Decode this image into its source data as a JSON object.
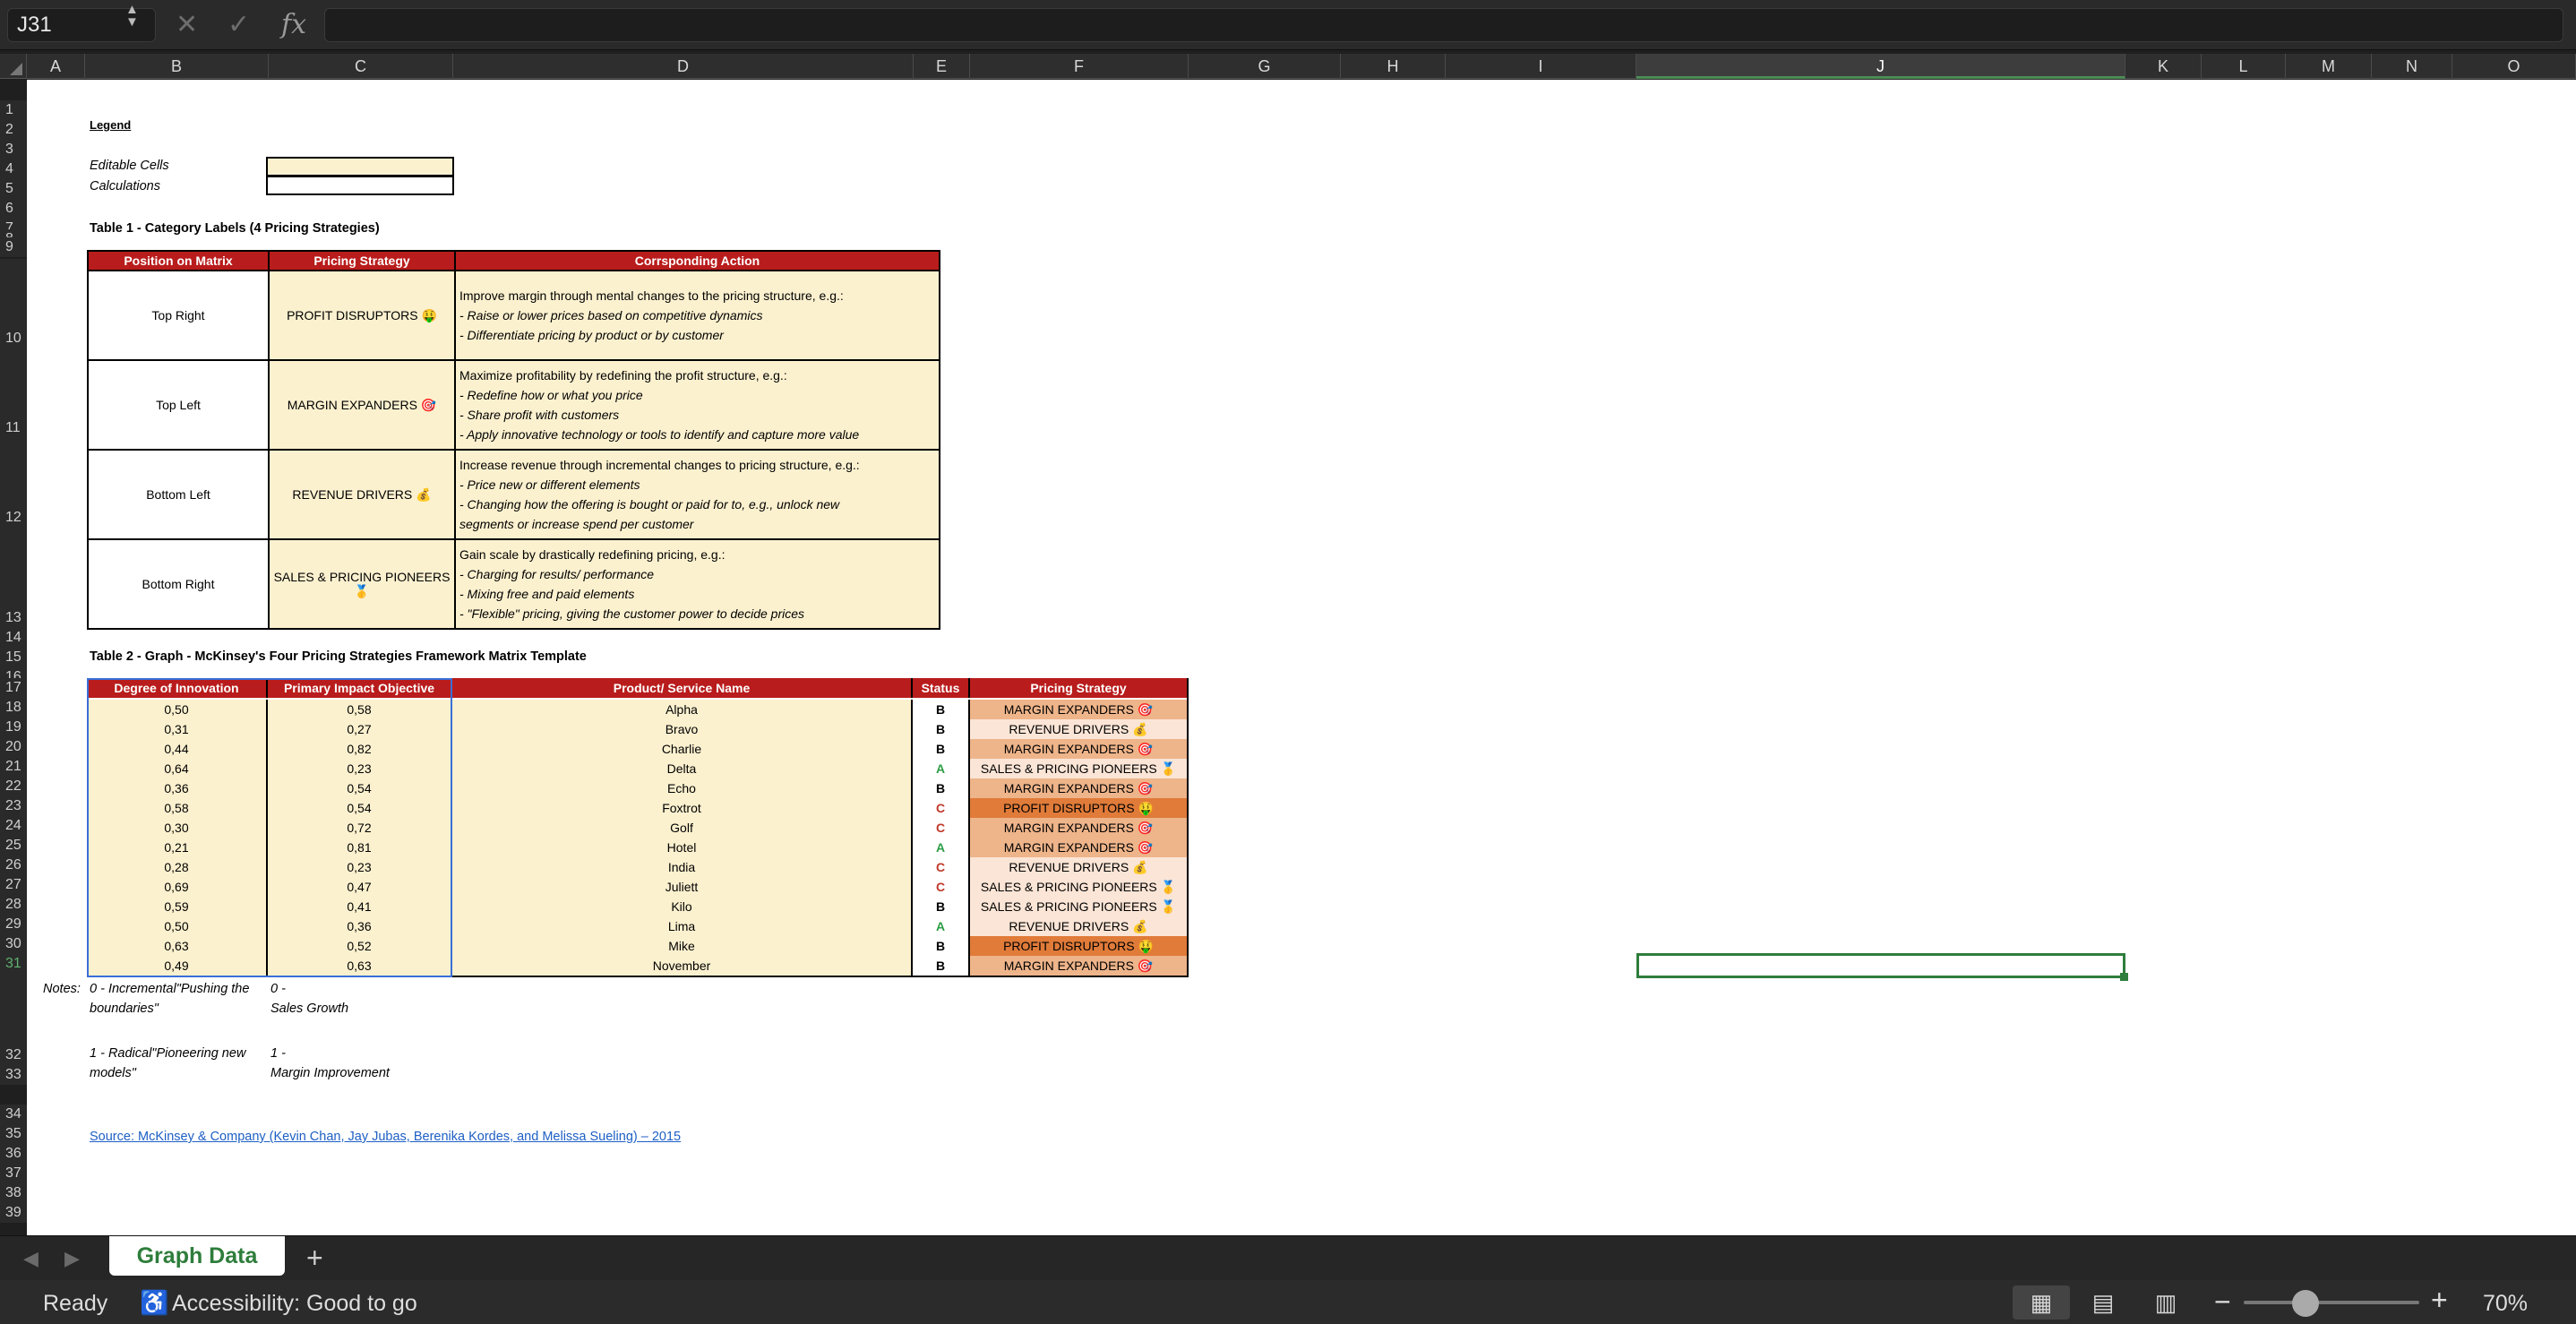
{
  "formula_bar": {
    "name_box": "J31",
    "cancel_icon": "✕",
    "enter_icon": "✓",
    "fx_label": "fx",
    "formula": ""
  },
  "columns": [
    "A",
    "B",
    "C",
    "D",
    "E",
    "F",
    "G",
    "H",
    "I",
    "J",
    "K",
    "L",
    "M",
    "N",
    "O"
  ],
  "selected_column": "J",
  "rows": [
    "1",
    "2",
    "3",
    "4",
    "5",
    "6",
    "7",
    "8",
    "9",
    "10",
    "11",
    "12",
    "13",
    "14",
    "15",
    "16",
    "17",
    "18",
    "19",
    "20",
    "21",
    "22",
    "23",
    "24",
    "25",
    "26",
    "27",
    "28",
    "29",
    "30",
    "31",
    "32",
    "33",
    "34",
    "35",
    "36",
    "37",
    "38",
    "39"
  ],
  "selected_row": "31",
  "legend": {
    "title": "Legend",
    "editable": "Editable Cells",
    "calculations": "Calculations"
  },
  "table1": {
    "title": "Table 1 - Category Labels (4 Pricing Strategies)",
    "headers": [
      "Position on Matrix",
      "Pricing Strategy",
      "Corrsponding Action"
    ],
    "rows": [
      {
        "position": "Top Right",
        "strategy": "PROFIT DISRUPTORS 🤑",
        "action_intro": "Improve margin through mental changes to the pricing structure, e.g.:",
        "action_items": [
          "- Raise or lower prices based on competitive dynamics",
          "- Differentiate pricing by product or by customer"
        ]
      },
      {
        "position": "Top Left",
        "strategy": "MARGIN EXPANDERS 🎯",
        "action_intro": "Maximize profitability by redefining the profit structure, e.g.:",
        "action_items": [
          "- Redefine how or what you price",
          "- Share profit with customers",
          "- Apply innovative technology or tools to identify and capture more value"
        ]
      },
      {
        "position": "Bottom Left",
        "strategy": "REVENUE DRIVERS 💰",
        "action_intro": "Increase revenue through incremental changes to pricing structure, e.g.:",
        "action_items": [
          "- Price new or different elements",
          "- Changing how the offering is bought or paid for to, e.g., unlock new",
          "segments or increase spend per customer"
        ]
      },
      {
        "position": "Bottom Right",
        "strategy": "SALES & PRICING PIONEERS 🥇",
        "action_intro": "Gain scale by drastically redefining pricing, e.g.:",
        "action_items": [
          "- Charging for results/ performance",
          "- Mixing free and paid elements",
          "- \"Flexible\" pricing, giving the customer power to decide prices"
        ]
      }
    ]
  },
  "table2": {
    "title": "Table 2 - Graph - McKinsey's Four Pricing Strategies Framework Matrix Template",
    "headers": [
      "Degree of Innovation",
      "Primary Impact Objective",
      "Product/ Service Name",
      "Status",
      "Pricing Strategy"
    ],
    "rows": [
      {
        "innovation": "0,50",
        "impact": "0,58",
        "name": "Alpha",
        "status": "B",
        "strategy": "MARGIN EXPANDERS 🎯"
      },
      {
        "innovation": "0,31",
        "impact": "0,27",
        "name": "Bravo",
        "status": "B",
        "strategy": "REVENUE DRIVERS 💰"
      },
      {
        "innovation": "0,44",
        "impact": "0,82",
        "name": "Charlie",
        "status": "B",
        "strategy": "MARGIN EXPANDERS 🎯"
      },
      {
        "innovation": "0,64",
        "impact": "0,23",
        "name": "Delta",
        "status": "A",
        "strategy": "SALES & PRICING PIONEERS 🥇"
      },
      {
        "innovation": "0,36",
        "impact": "0,54",
        "name": "Echo",
        "status": "B",
        "strategy": "MARGIN EXPANDERS 🎯"
      },
      {
        "innovation": "0,58",
        "impact": "0,54",
        "name": "Foxtrot",
        "status": "C",
        "strategy": "PROFIT DISRUPTORS 🤑"
      },
      {
        "innovation": "0,30",
        "impact": "0,72",
        "name": "Golf",
        "status": "C",
        "strategy": "MARGIN EXPANDERS 🎯"
      },
      {
        "innovation": "0,21",
        "impact": "0,81",
        "name": "Hotel",
        "status": "A",
        "strategy": "MARGIN EXPANDERS 🎯"
      },
      {
        "innovation": "0,28",
        "impact": "0,23",
        "name": "India",
        "status": "C",
        "strategy": "REVENUE DRIVERS 💰"
      },
      {
        "innovation": "0,69",
        "impact": "0,47",
        "name": "Juliett",
        "status": "C",
        "strategy": "SALES & PRICING PIONEERS 🥇"
      },
      {
        "innovation": "0,59",
        "impact": "0,41",
        "name": "Kilo",
        "status": "B",
        "strategy": "SALES & PRICING PIONEERS 🥇"
      },
      {
        "innovation": "0,50",
        "impact": "0,36",
        "name": "Lima",
        "status": "A",
        "strategy": "REVENUE DRIVERS 💰"
      },
      {
        "innovation": "0,63",
        "impact": "0,52",
        "name": "Mike",
        "status": "B",
        "strategy": "PROFIT DISRUPTORS 🤑"
      },
      {
        "innovation": "0,49",
        "impact": "0,63",
        "name": "November",
        "status": "B",
        "strategy": "MARGIN EXPANDERS 🎯"
      }
    ]
  },
  "notes": {
    "label": "Notes:",
    "innov_0_line1": "0 - Incremental\"Pushing the",
    "innov_0_line2": "boundaries\"",
    "impact_0_line1": "0 -",
    "impact_0_line2": "Sales Growth",
    "innov_1_line1": "1 - Radical\"Pioneering new",
    "innov_1_line2": "models\"",
    "impact_1_line1": "1 -",
    "impact_1_line2": "Margin Improvement"
  },
  "source": "Source: McKinsey & Company (Kevin Chan, Jay Jubas, Berenika Kordes, and Melissa Sueling) – 2015",
  "strategy_colors": {
    "MARGIN EXPANDERS": "#eeb48a",
    "REVENUE DRIVERS": "#fbe5d6",
    "SALES & PRICING PIONEERS": "#fbe5d6",
    "PROFIT DISRUPTORS": "#e07b39"
  },
  "accent": {
    "header_red": "#b91c1c",
    "cream": "#fcf1cf",
    "selection_green": "#2e7d3b"
  },
  "sheet_tabs": {
    "active": "Graph Data",
    "add_icon": "+"
  },
  "status_bar": {
    "ready": "Ready",
    "accessibility": "Accessibility: Good to go",
    "zoom_minus": "−",
    "zoom_plus": "+",
    "zoom": "70%",
    "zoom_fraction": 0.35
  }
}
